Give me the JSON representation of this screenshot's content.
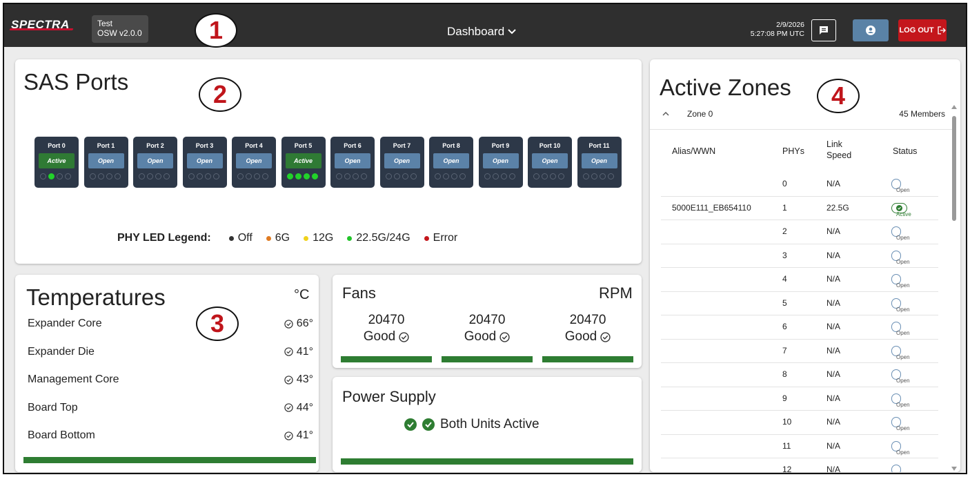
{
  "header": {
    "logo": "SPECTRA",
    "version_line1": "Test",
    "version_line2": "OSW v2.0.0",
    "nav_title": "Dashboard",
    "date": "2/9/2026",
    "time": "5:27:08 PM UTC",
    "logout_label": "LOG OUT"
  },
  "callouts": [
    "1",
    "2",
    "3",
    "4"
  ],
  "sas": {
    "title": "SAS Ports",
    "ports": [
      {
        "name": "Port 0",
        "status": "Active",
        "leds": [
          false,
          true,
          false,
          false
        ]
      },
      {
        "name": "Port 1",
        "status": "Open",
        "leds": [
          false,
          false,
          false,
          false
        ]
      },
      {
        "name": "Port 2",
        "status": "Open",
        "leds": [
          false,
          false,
          false,
          false
        ]
      },
      {
        "name": "Port 3",
        "status": "Open",
        "leds": [
          false,
          false,
          false,
          false
        ]
      },
      {
        "name": "Port 4",
        "status": "Open",
        "leds": [
          false,
          false,
          false,
          false
        ]
      },
      {
        "name": "Port 5",
        "status": "Active",
        "leds": [
          true,
          true,
          true,
          true
        ]
      },
      {
        "name": "Port 6",
        "status": "Open",
        "leds": [
          false,
          false,
          false,
          false
        ]
      },
      {
        "name": "Port 7",
        "status": "Open",
        "leds": [
          false,
          false,
          false,
          false
        ]
      },
      {
        "name": "Port 8",
        "status": "Open",
        "leds": [
          false,
          false,
          false,
          false
        ]
      },
      {
        "name": "Port 9",
        "status": "Open",
        "leds": [
          false,
          false,
          false,
          false
        ]
      },
      {
        "name": "Port 10",
        "status": "Open",
        "leds": [
          false,
          false,
          false,
          false
        ]
      },
      {
        "name": "Port 11",
        "status": "Open",
        "leds": [
          false,
          false,
          false,
          false
        ]
      }
    ],
    "legend_title": "PHY LED Legend:",
    "legend": [
      {
        "label": "Off",
        "color": "#333333"
      },
      {
        "label": "6G",
        "color": "#e07b22"
      },
      {
        "label": "12G",
        "color": "#f0d21c"
      },
      {
        "label": "22.5G/24G",
        "color": "#22c42a"
      },
      {
        "label": "Error",
        "color": "#c4161c"
      }
    ]
  },
  "temperatures": {
    "title": "Temperatures",
    "unit": "°C",
    "rows": [
      {
        "label": "Expander Core",
        "value": "66°"
      },
      {
        "label": "Expander Die",
        "value": "41°"
      },
      {
        "label": "Management Core",
        "value": "43°"
      },
      {
        "label": "Board Top",
        "value": "44°"
      },
      {
        "label": "Board Bottom",
        "value": "41°"
      }
    ]
  },
  "fans": {
    "title": "Fans",
    "unit": "RPM",
    "items": [
      {
        "rpm": "20470",
        "status": "Good"
      },
      {
        "rpm": "20470",
        "status": "Good"
      },
      {
        "rpm": "20470",
        "status": "Good"
      }
    ]
  },
  "power": {
    "title": "Power Supply",
    "status": "Both Units Active"
  },
  "zones": {
    "title": "Active Zones",
    "zone_name": "Zone 0",
    "members": "45 Members",
    "columns": {
      "alias": "Alias/WWN",
      "phys": "PHYs",
      "link_speed_1": "Link",
      "link_speed_2": "Speed",
      "status": "Status"
    },
    "rows": [
      {
        "alias": "",
        "phy": "0",
        "speed": "N/A",
        "status": "Open"
      },
      {
        "alias": "5000E111_EB654110",
        "phy": "1",
        "speed": "22.5G",
        "status": "Active"
      },
      {
        "alias": "",
        "phy": "2",
        "speed": "N/A",
        "status": "Open"
      },
      {
        "alias": "",
        "phy": "3",
        "speed": "N/A",
        "status": "Open"
      },
      {
        "alias": "",
        "phy": "4",
        "speed": "N/A",
        "status": "Open"
      },
      {
        "alias": "",
        "phy": "5",
        "speed": "N/A",
        "status": "Open"
      },
      {
        "alias": "",
        "phy": "6",
        "speed": "N/A",
        "status": "Open"
      },
      {
        "alias": "",
        "phy": "7",
        "speed": "N/A",
        "status": "Open"
      },
      {
        "alias": "",
        "phy": "8",
        "speed": "N/A",
        "status": "Open"
      },
      {
        "alias": "",
        "phy": "9",
        "speed": "N/A",
        "status": "Open"
      },
      {
        "alias": "",
        "phy": "10",
        "speed": "N/A",
        "status": "Open"
      },
      {
        "alias": "",
        "phy": "11",
        "speed": "N/A",
        "status": "Open"
      },
      {
        "alias": "",
        "phy": "12",
        "speed": "N/A",
        "status": "Open"
      }
    ]
  },
  "colors": {
    "accent_green": "#2e7d32",
    "open_blue": "#5b82a8",
    "logout_red": "#c4161c",
    "topbar": "#2f2f2f"
  }
}
